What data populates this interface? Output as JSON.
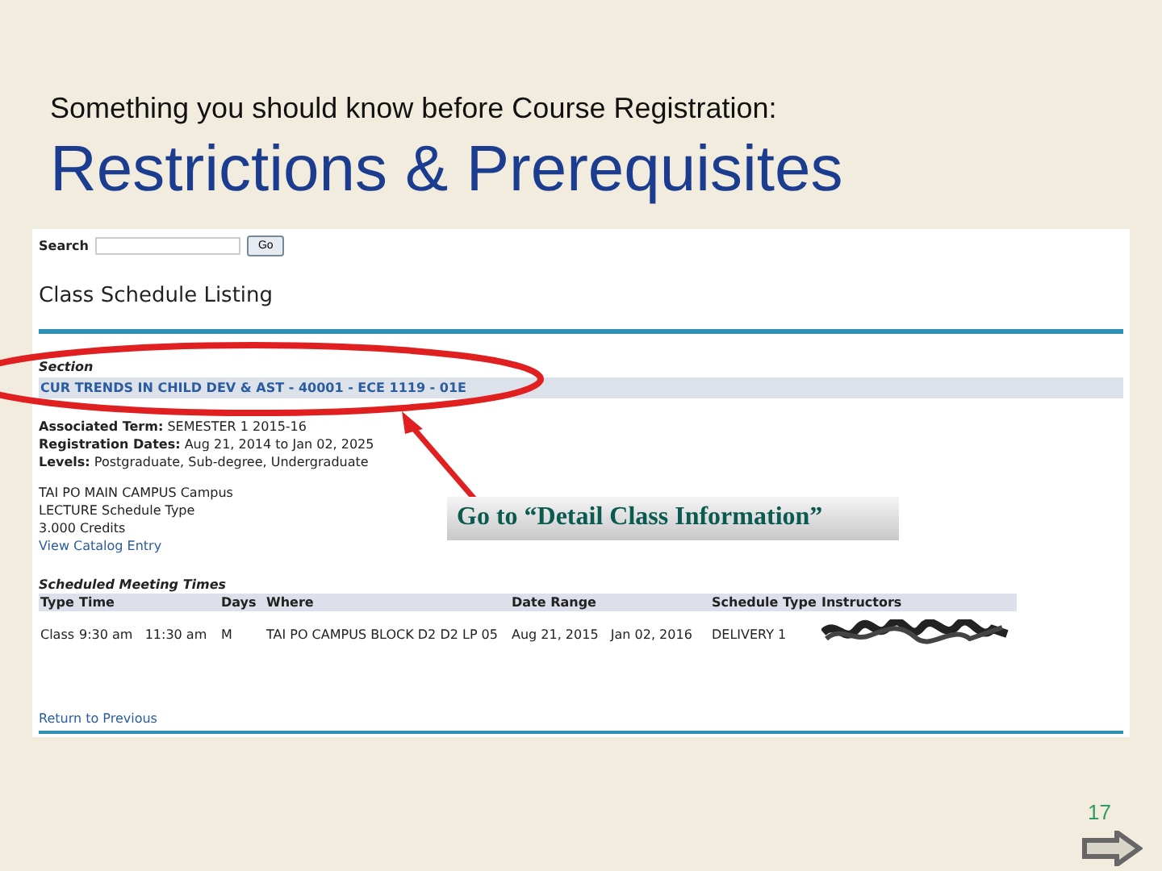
{
  "slide": {
    "subtitle": "Something you should know before Course Registration:",
    "title": "Restrictions & Prerequisites",
    "page_number": "17"
  },
  "screenshot": {
    "search": {
      "label": "Search",
      "button": "Go"
    },
    "heading": "Class Schedule Listing",
    "section_label": "Section",
    "course_link": "CUR TRENDS IN CHILD DEV & AST - 40001 - ECE 1119 - 01E",
    "details": [
      "**Associated Term:** SEMESTER 1 2015-16",
      "**Registration Dates:** Aug 21, 2014 to Jan 02, 2025",
      "**Levels:** Postgraduate, Sub-degree, Undergraduate"
    ],
    "info": [
      "TAI PO MAIN CAMPUS Campus",
      "LECTURE Schedule Type",
      "3.000 Credits"
    ],
    "catalog_link": "View Catalog Entry",
    "meeting": {
      "title": "Scheduled Meeting Times",
      "columns": [
        "Type",
        "Time",
        "Days",
        "Where",
        "Date Range",
        "Schedule Type",
        "Instructors"
      ],
      "rows": [
        [
          "Class",
          "9:30 am   11:30 am",
          "M",
          "TAI PO CAMPUS BLOCK D2 D2 LP 05",
          "Aug 21, 2015   Jan 02, 2016",
          "DELIVERY 1"
        ]
      ]
    },
    "return_link": "Return to Previous"
  },
  "callout": "Go to “Detail Class Information”"
}
